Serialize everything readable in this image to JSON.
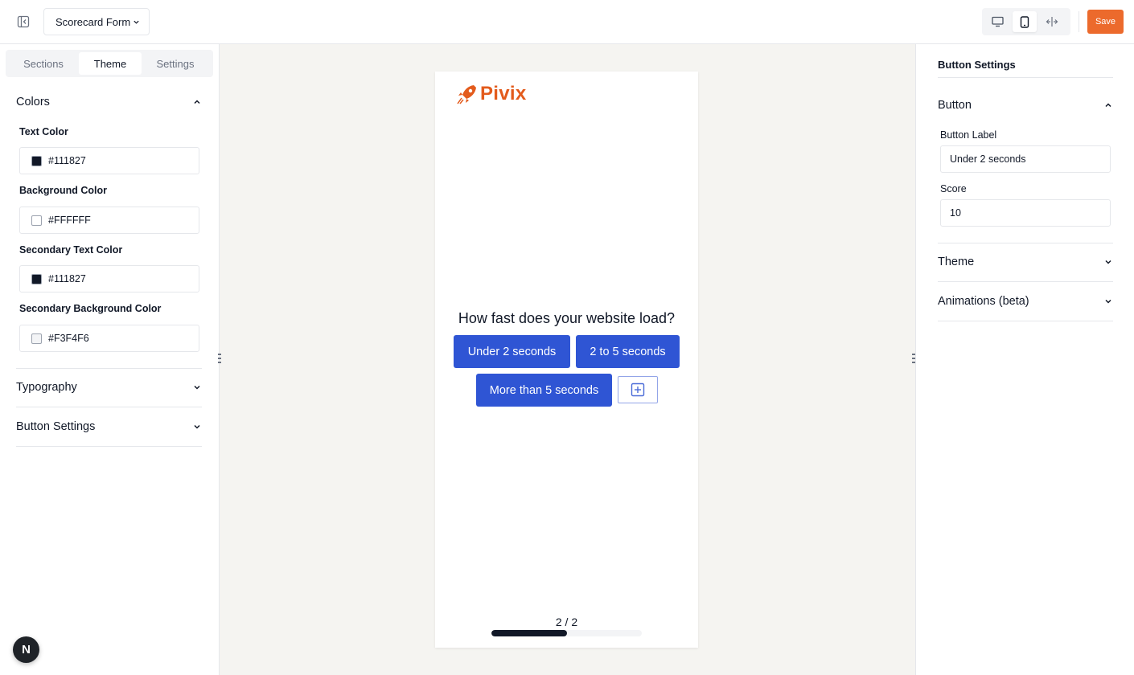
{
  "topbar": {
    "form_name": "Scorecard Form",
    "save_label": "Save",
    "devices": [
      "desktop-icon",
      "mobile-icon",
      "split-view-icon"
    ],
    "active_device": "mobile"
  },
  "left_panel": {
    "tabs": [
      "Sections",
      "Theme",
      "Settings"
    ],
    "active_tab": "Theme",
    "colors_section": {
      "title": "Colors",
      "fields": [
        {
          "label": "Text Color",
          "value": "#111827",
          "swatch": "#111827"
        },
        {
          "label": "Background Color",
          "value": "#FFFFFF",
          "swatch": "#FFFFFF"
        },
        {
          "label": "Secondary Text Color",
          "value": "#111827",
          "swatch": "#111827"
        },
        {
          "label": "Secondary Background Color",
          "value": "#F3F4F6",
          "swatch": "#F3F4F6"
        }
      ]
    },
    "typography_title": "Typography",
    "button_settings_title": "Button Settings",
    "avatar_letter": "N"
  },
  "canvas": {
    "logo_text": "Pivix",
    "question": "How fast does your website load?",
    "choices": [
      "Under 2 seconds",
      "2 to 5 seconds",
      "More than 5 seconds"
    ],
    "progress_text": "2 / 2",
    "progress_fraction": 0.5,
    "accent_color": "#2f55d4",
    "brand_color": "#e35b1c"
  },
  "right_panel": {
    "title": "Button Settings",
    "button_section": {
      "title": "Button",
      "label_field": {
        "label": "Button Label",
        "value": "Under 2 seconds"
      },
      "score_field": {
        "label": "Score",
        "value": "10"
      }
    },
    "theme_title": "Theme",
    "animations_title": "Animations (beta)"
  }
}
